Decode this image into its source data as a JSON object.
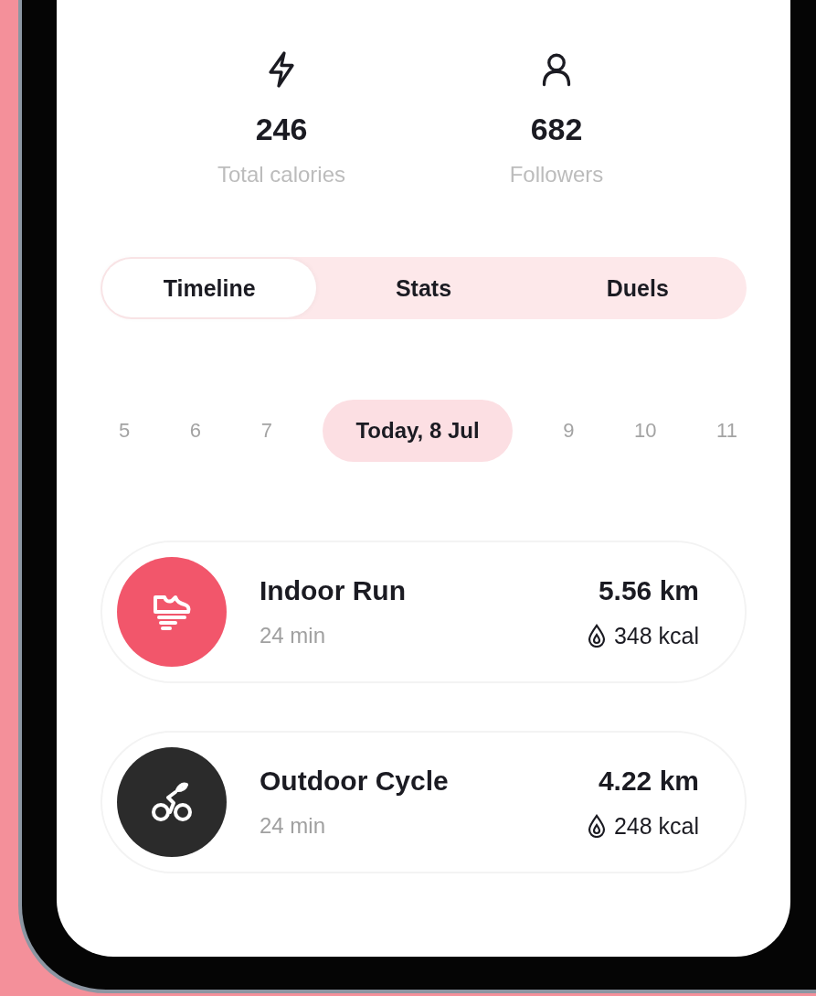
{
  "stats": [
    {
      "kind": "energy",
      "value": "246",
      "label": "Total calories"
    },
    {
      "kind": "person",
      "value": "682",
      "label": "Followers"
    }
  ],
  "tabs": [
    {
      "label": "Timeline",
      "selected": true
    },
    {
      "label": "Stats",
      "selected": false
    },
    {
      "label": "Duels",
      "selected": false
    }
  ],
  "dates": [
    {
      "label": "5",
      "selected": false
    },
    {
      "label": "6",
      "selected": false
    },
    {
      "label": "7",
      "selected": false
    },
    {
      "label": "Today, 8 Jul",
      "selected": true
    },
    {
      "label": "9",
      "selected": false
    },
    {
      "label": "10",
      "selected": false
    },
    {
      "label": "11",
      "selected": false
    }
  ],
  "activities": [
    {
      "kind": "run",
      "color": "#f2566b",
      "title": "Indoor Run",
      "duration": "24 min",
      "distance": "5.56 km",
      "calories": "348 kcal"
    },
    {
      "kind": "cycle",
      "color": "#2b2b2b",
      "title": "Outdoor Cycle",
      "duration": "24 min",
      "distance": "4.22 km",
      "calories": "248 kcal"
    }
  ]
}
